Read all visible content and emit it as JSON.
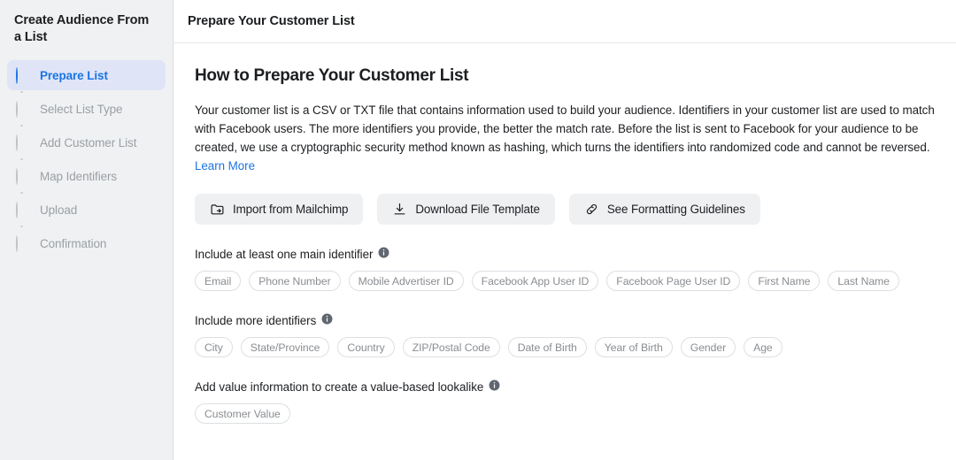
{
  "sidebar": {
    "title": "Create Audience From a List",
    "steps": [
      {
        "label": "Prepare List",
        "state": "active",
        "icon": "half-filled-circle-icon"
      },
      {
        "label": "Select List Type",
        "state": "pending",
        "icon": "empty-circle-icon"
      },
      {
        "label": "Add Customer List",
        "state": "pending",
        "icon": "empty-circle-icon"
      },
      {
        "label": "Map Identifiers",
        "state": "pending",
        "icon": "empty-circle-icon"
      },
      {
        "label": "Upload",
        "state": "pending",
        "icon": "empty-circle-icon"
      },
      {
        "label": "Confirmation",
        "state": "pending",
        "icon": "empty-circle-icon"
      }
    ]
  },
  "header": {
    "title": "Prepare Your Customer List"
  },
  "main": {
    "heading": "How to Prepare Your Customer List",
    "paragraph": "Your customer list is a CSV or TXT file that contains information used to build your audience. Identifiers in your customer list are used to match with Facebook users. The more identifiers you provide, the better the match rate. Before the list is sent to Facebook for your audience to be created, we use a cryptographic security method known as hashing, which turns the identifiers into randomized code and cannot be reversed. ",
    "learn_more": "Learn More",
    "buttons": [
      {
        "label": "Import from Mailchimp",
        "icon": "folder-import-icon"
      },
      {
        "label": "Download File Template",
        "icon": "download-icon"
      },
      {
        "label": "See Formatting Guidelines",
        "icon": "link-icon"
      }
    ],
    "groups": [
      {
        "label": "Include at least one main identifier",
        "info_icon": "info-icon",
        "chips": [
          "Email",
          "Phone Number",
          "Mobile Advertiser ID",
          "Facebook App User ID",
          "Facebook Page User ID",
          "First Name",
          "Last Name"
        ]
      },
      {
        "label": "Include more identifiers",
        "info_icon": "info-icon",
        "chips": [
          "City",
          "State/Province",
          "Country",
          "ZIP/Postal Code",
          "Date of Birth",
          "Year of Birth",
          "Gender",
          "Age"
        ]
      },
      {
        "label": "Add value information to create a value-based lookalike",
        "info_icon": "info-icon",
        "chips": [
          "Customer Value"
        ]
      }
    ]
  },
  "colors": {
    "accent": "#1b74e4",
    "active_pill": "#dfe5f7",
    "sidebar_bg": "#f0f1f2",
    "chip_border": "#dcdfe3",
    "muted_text": "#8a8d91"
  }
}
